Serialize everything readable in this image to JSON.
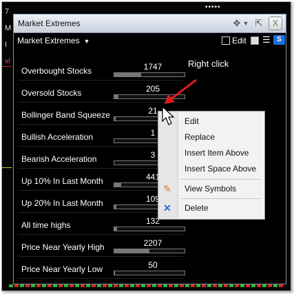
{
  "background": {
    "left_labels": [
      "7",
      "M",
      "",
      "I",
      "vi"
    ],
    "top_dots": "•••••"
  },
  "window": {
    "title": "Market Extremes",
    "close_label": "X",
    "dropdown_label": "Market Extremes",
    "edit_label": "Edit",
    "s_label": "S",
    "accent_color": "#1e6fd8"
  },
  "rows": [
    {
      "label": "Overbought Stocks",
      "value": "1747",
      "fill": 0.38
    },
    {
      "label": "Oversold Stocks",
      "value": "205",
      "fill": 0.06
    },
    {
      "label": "Bollinger Band Squeeze",
      "value": "21",
      "fill": 0.02
    },
    {
      "label": "Bullish Acceleration",
      "value": "1",
      "fill": 0.0
    },
    {
      "label": "Bearish Acceleration",
      "value": "3",
      "fill": 0.0
    },
    {
      "label": "Up 10% In Last Month",
      "value": "441",
      "fill": 0.1
    },
    {
      "label": "Up 20% In Last Month",
      "value": "109",
      "fill": 0.03
    },
    {
      "label": "All time highs",
      "value": "132",
      "fill": 0.04
    },
    {
      "label": "Price Near Yearly High",
      "value": "2207",
      "fill": 0.5
    },
    {
      "label": "Price Near Yearly Low",
      "value": "50",
      "fill": 0.01
    }
  ],
  "annotation": {
    "text": "Right click",
    "arrow_color": "#e01b1b"
  },
  "context_menu": {
    "items": [
      "Edit",
      "Replace",
      "Insert Item Above",
      "Insert Space Above",
      "View Symbols",
      "Delete"
    ]
  }
}
